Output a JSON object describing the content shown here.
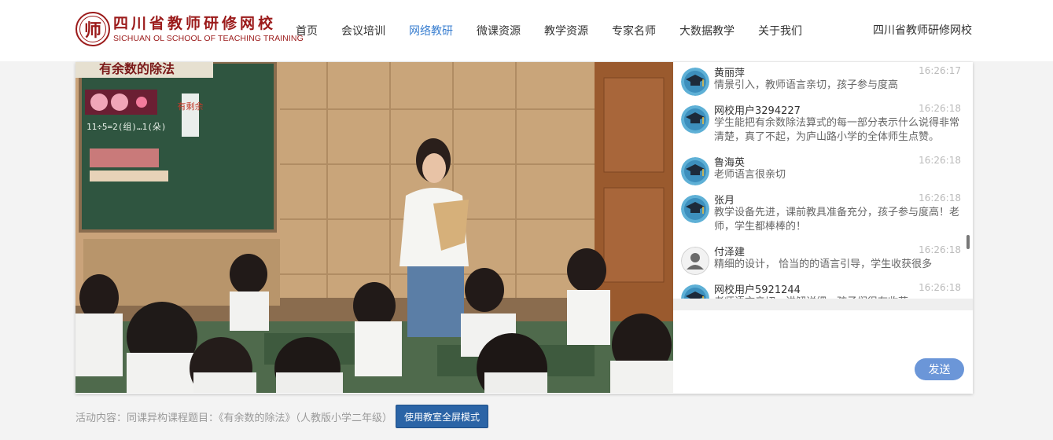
{
  "header": {
    "logo_seal": "师",
    "logo_cn": "四川省教师研修网校",
    "logo_en": "SICHUAN OL SCHOOL OF TEACHING TRAINING",
    "nav": [
      "首页",
      "会议培训",
      "网络教研",
      "微课资源",
      "教学资源",
      "专家名师",
      "大数据教学",
      "关于我们"
    ],
    "active_nav": "网络教研",
    "site_name": "四川省教师研修网校"
  },
  "video": {
    "board_title": "有余数的除法",
    "board_side": "有剩余",
    "board_eq": "11÷5=2(组)…1(朵)"
  },
  "chat": {
    "messages": [
      {
        "name": "黄丽萍",
        "time": "16:26:17",
        "text": "情景引入，教师语言亲切，孩子参与度高",
        "avatar": "graduate-avatar"
      },
      {
        "name": "网校用户3294227",
        "time": "16:26:18",
        "text": "学生能把有余数除法算式的每一部分表示什么说得非常清楚，真了不起，为庐山路小学的全体师生点赞。",
        "avatar": "graduate-avatar"
      },
      {
        "name": "鲁海英",
        "time": "16:26:18",
        "text": "老师语言很亲切",
        "avatar": "graduate-avatar"
      },
      {
        "name": "张月",
        "time": "16:26:18",
        "text": "教学设备先进，课前教具准备充分，孩子参与度高！老师，学生都棒棒的！",
        "avatar": "graduate-avatar"
      },
      {
        "name": "付泽建",
        "time": "16:26:18",
        "text": "精细的设计， 恰当的的语言引导，学生收获很多",
        "avatar": "default-user-avatar"
      },
      {
        "name": "网校用户5921244",
        "time": "16:26:18",
        "text": "老师语言亲切，讲解详细，孩子们很有收获",
        "avatar": "graduate-avatar"
      }
    ],
    "send_label": "发送"
  },
  "footer": {
    "activity_text": "活动内容：同课异构课程题目：《有余数的除法》（人教版小学二年级）",
    "fullscreen_label": "使用教室全屏模式"
  },
  "colors": {
    "brand": "#9b1a1a",
    "nav_active": "#3a7fd0",
    "send_button": "#6b96d8",
    "fullscreen_button": "#2b64a6"
  }
}
